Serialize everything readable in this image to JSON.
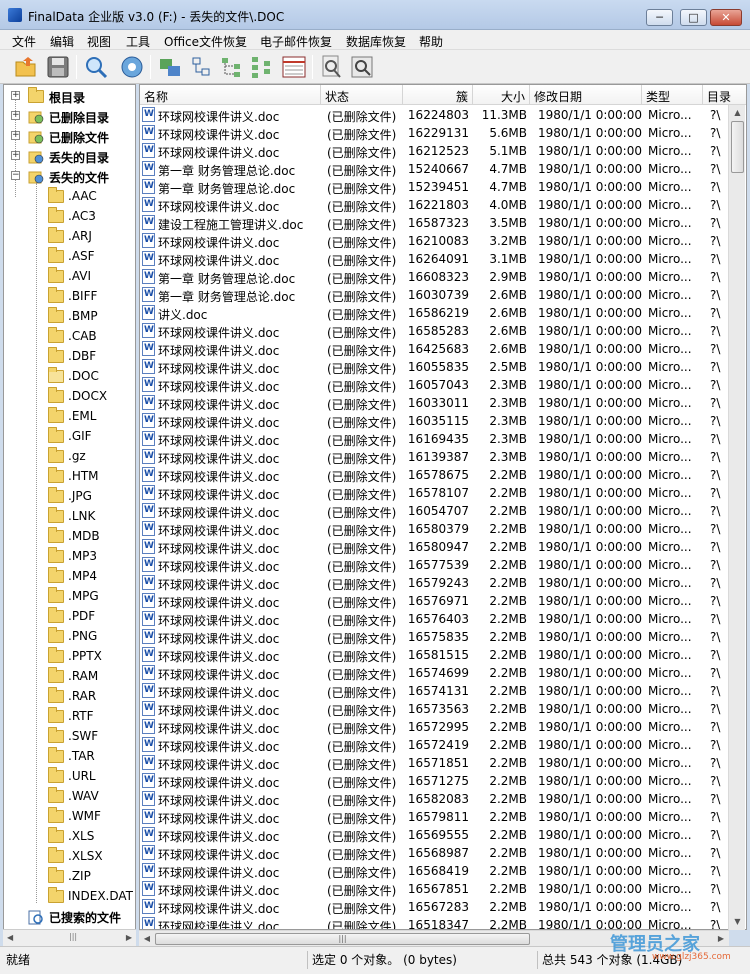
{
  "window": {
    "title": "FinalData 企业版 v3.0 (F:) - 丢失的文件\\.DOC",
    "minimize": "─",
    "maximize": "□",
    "close": "✕"
  },
  "menu": [
    "文件",
    "编辑",
    "视图",
    "工具",
    "Office文件恢复",
    "电子邮件恢复",
    "数据库恢复",
    "帮助"
  ],
  "toolbar_icons": [
    "open-folder-icon",
    "save-icon",
    "search-icon",
    "settings-gear-icon",
    "recover-icon",
    "tree-view-icon",
    "branch-icon",
    "hierarchy-icon",
    "detail-list-icon",
    "find-icon",
    "properties-icon"
  ],
  "tree": {
    "roots": [
      {
        "label": "根目录",
        "icon": "folder-icon"
      },
      {
        "label": "已删除目录",
        "icon": "deleted-folder-icon"
      },
      {
        "label": "已删除文件",
        "icon": "deleted-file-icon"
      },
      {
        "label": "丢失的目录",
        "icon": "lost-folder-icon"
      },
      {
        "label": "丢失的文件",
        "icon": "lost-file-icon"
      }
    ],
    "children": [
      ".AAC",
      ".AC3",
      ".ARJ",
      ".ASF",
      ".AVI",
      ".BIFF",
      ".BMP",
      ".CAB",
      ".DBF",
      ".DOC",
      ".DOCX",
      ".EML",
      ".GIF",
      ".gz",
      ".HTM",
      ".JPG",
      ".LNK",
      ".MDB",
      ".MP3",
      ".MP4",
      ".MPG",
      ".PDF",
      ".PNG",
      ".PPTX",
      ".RAM",
      ".RAR",
      ".RTF",
      ".SWF",
      ".TAR",
      ".URL",
      ".WAV",
      ".WMF",
      ".XLS",
      ".XLSX",
      ".ZIP",
      "INDEX.DAT"
    ],
    "search_result": "已搜索的文件"
  },
  "list": {
    "columns": [
      "名称",
      "状态",
      "簇",
      "大小",
      "修改日期",
      "类型",
      "目录"
    ],
    "rows": [
      [
        "环球网校课件讲义.doc",
        "(已删除文件)",
        "16224803",
        "11.3MB",
        "1980/1/1 0:00:00",
        "Micro...",
        "?\\"
      ],
      [
        "环球网校课件讲义.doc",
        "(已删除文件)",
        "16229131",
        "5.6MB",
        "1980/1/1 0:00:00",
        "Micro...",
        "?\\"
      ],
      [
        "环球网校课件讲义.doc",
        "(已删除文件)",
        "16212523",
        "5.1MB",
        "1980/1/1 0:00:00",
        "Micro...",
        "?\\"
      ],
      [
        "第一章  财务管理总论.doc",
        "(已删除文件)",
        "15240667",
        "4.7MB",
        "1980/1/1 0:00:00",
        "Micro...",
        "?\\"
      ],
      [
        "第一章  财务管理总论.doc",
        "(已删除文件)",
        "15239451",
        "4.7MB",
        "1980/1/1 0:00:00",
        "Micro...",
        "?\\"
      ],
      [
        "环球网校课件讲义.doc",
        "(已删除文件)",
        "16221803",
        "4.0MB",
        "1980/1/1 0:00:00",
        "Micro...",
        "?\\"
      ],
      [
        "建设工程施工管理讲义.doc",
        "(已删除文件)",
        "16587323",
        "3.5MB",
        "1980/1/1 0:00:00",
        "Micro...",
        "?\\"
      ],
      [
        "环球网校课件讲义.doc",
        "(已删除文件)",
        "16210083",
        "3.2MB",
        "1980/1/1 0:00:00",
        "Micro...",
        "?\\"
      ],
      [
        "环球网校课件讲义.doc",
        "(已删除文件)",
        "16264091",
        "3.1MB",
        "1980/1/1 0:00:00",
        "Micro...",
        "?\\"
      ],
      [
        "第一章  财务管理总论.doc",
        "(已删除文件)",
        "16608323",
        "2.9MB",
        "1980/1/1 0:00:00",
        "Micro...",
        "?\\"
      ],
      [
        "第一章  财务管理总论.doc",
        "(已删除文件)",
        "16030739",
        "2.6MB",
        "1980/1/1 0:00:00",
        "Micro...",
        "?\\"
      ],
      [
        "讲义.doc",
        "(已删除文件)",
        "16586219",
        "2.6MB",
        "1980/1/1 0:00:00",
        "Micro...",
        "?\\"
      ],
      [
        "环球网校课件讲义.doc",
        "(已删除文件)",
        "16585283",
        "2.6MB",
        "1980/1/1 0:00:00",
        "Micro...",
        "?\\"
      ],
      [
        "环球网校课件讲义.doc",
        "(已删除文件)",
        "16425683",
        "2.6MB",
        "1980/1/1 0:00:00",
        "Micro...",
        "?\\"
      ],
      [
        "环球网校课件讲义.doc",
        "(已删除文件)",
        "16055835",
        "2.5MB",
        "1980/1/1 0:00:00",
        "Micro...",
        "?\\"
      ],
      [
        "环球网校课件讲义.doc",
        "(已删除文件)",
        "16057043",
        "2.3MB",
        "1980/1/1 0:00:00",
        "Micro...",
        "?\\"
      ],
      [
        "环球网校课件讲义.doc",
        "(已删除文件)",
        "16033011",
        "2.3MB",
        "1980/1/1 0:00:00",
        "Micro...",
        "?\\"
      ],
      [
        "环球网校课件讲义.doc",
        "(已删除文件)",
        "16035115",
        "2.3MB",
        "1980/1/1 0:00:00",
        "Micro...",
        "?\\"
      ],
      [
        "环球网校课件讲义.doc",
        "(已删除文件)",
        "16169435",
        "2.3MB",
        "1980/1/1 0:00:00",
        "Micro...",
        "?\\"
      ],
      [
        "环球网校课件讲义.doc",
        "(已删除文件)",
        "16139387",
        "2.3MB",
        "1980/1/1 0:00:00",
        "Micro...",
        "?\\"
      ],
      [
        "环球网校课件讲义.doc",
        "(已删除文件)",
        "16578675",
        "2.2MB",
        "1980/1/1 0:00:00",
        "Micro...",
        "?\\"
      ],
      [
        "环球网校课件讲义.doc",
        "(已删除文件)",
        "16578107",
        "2.2MB",
        "1980/1/1 0:00:00",
        "Micro...",
        "?\\"
      ],
      [
        "环球网校课件讲义.doc",
        "(已删除文件)",
        "16054707",
        "2.2MB",
        "1980/1/1 0:00:00",
        "Micro...",
        "?\\"
      ],
      [
        "环球网校课件讲义.doc",
        "(已删除文件)",
        "16580379",
        "2.2MB",
        "1980/1/1 0:00:00",
        "Micro...",
        "?\\"
      ],
      [
        "环球网校课件讲义.doc",
        "(已删除文件)",
        "16580947",
        "2.2MB",
        "1980/1/1 0:00:00",
        "Micro...",
        "?\\"
      ],
      [
        "环球网校课件讲义.doc",
        "(已删除文件)",
        "16577539",
        "2.2MB",
        "1980/1/1 0:00:00",
        "Micro...",
        "?\\"
      ],
      [
        "环球网校课件讲义.doc",
        "(已删除文件)",
        "16579243",
        "2.2MB",
        "1980/1/1 0:00:00",
        "Micro...",
        "?\\"
      ],
      [
        "环球网校课件讲义.doc",
        "(已删除文件)",
        "16576971",
        "2.2MB",
        "1980/1/1 0:00:00",
        "Micro...",
        "?\\"
      ],
      [
        "环球网校课件讲义.doc",
        "(已删除文件)",
        "16576403",
        "2.2MB",
        "1980/1/1 0:00:00",
        "Micro...",
        "?\\"
      ],
      [
        "环球网校课件讲义.doc",
        "(已删除文件)",
        "16575835",
        "2.2MB",
        "1980/1/1 0:00:00",
        "Micro...",
        "?\\"
      ],
      [
        "环球网校课件讲义.doc",
        "(已删除文件)",
        "16581515",
        "2.2MB",
        "1980/1/1 0:00:00",
        "Micro...",
        "?\\"
      ],
      [
        "环球网校课件讲义.doc",
        "(已删除文件)",
        "16574699",
        "2.2MB",
        "1980/1/1 0:00:00",
        "Micro...",
        "?\\"
      ],
      [
        "环球网校课件讲义.doc",
        "(已删除文件)",
        "16574131",
        "2.2MB",
        "1980/1/1 0:00:00",
        "Micro...",
        "?\\"
      ],
      [
        "环球网校课件讲义.doc",
        "(已删除文件)",
        "16573563",
        "2.2MB",
        "1980/1/1 0:00:00",
        "Micro...",
        "?\\"
      ],
      [
        "环球网校课件讲义.doc",
        "(已删除文件)",
        "16572995",
        "2.2MB",
        "1980/1/1 0:00:00",
        "Micro...",
        "?\\"
      ],
      [
        "环球网校课件讲义.doc",
        "(已删除文件)",
        "16572419",
        "2.2MB",
        "1980/1/1 0:00:00",
        "Micro...",
        "?\\"
      ],
      [
        "环球网校课件讲义.doc",
        "(已删除文件)",
        "16571851",
        "2.2MB",
        "1980/1/1 0:00:00",
        "Micro...",
        "?\\"
      ],
      [
        "环球网校课件讲义.doc",
        "(已删除文件)",
        "16571275",
        "2.2MB",
        "1980/1/1 0:00:00",
        "Micro...",
        "?\\"
      ],
      [
        "环球网校课件讲义.doc",
        "(已删除文件)",
        "16582083",
        "2.2MB",
        "1980/1/1 0:00:00",
        "Micro...",
        "?\\"
      ],
      [
        "环球网校课件讲义.doc",
        "(已删除文件)",
        "16579811",
        "2.2MB",
        "1980/1/1 0:00:00",
        "Micro...",
        "?\\"
      ],
      [
        "环球网校课件讲义.doc",
        "(已删除文件)",
        "16569555",
        "2.2MB",
        "1980/1/1 0:00:00",
        "Micro...",
        "?\\"
      ],
      [
        "环球网校课件讲义.doc",
        "(已删除文件)",
        "16568987",
        "2.2MB",
        "1980/1/1 0:00:00",
        "Micro...",
        "?\\"
      ],
      [
        "环球网校课件讲义.doc",
        "(已删除文件)",
        "16568419",
        "2.2MB",
        "1980/1/1 0:00:00",
        "Micro...",
        "?\\"
      ],
      [
        "环球网校课件讲义.doc",
        "(已删除文件)",
        "16567851",
        "2.2MB",
        "1980/1/1 0:00:00",
        "Micro...",
        "?\\"
      ],
      [
        "环球网校课件讲义.doc",
        "(已删除文件)",
        "16567283",
        "2.2MB",
        "1980/1/1 0:00:00",
        "Micro...",
        "?\\"
      ],
      [
        "环球网校课件讲义.doc",
        "(已删除文件)",
        "16518347",
        "2.2MB",
        "1980/1/1 0:00:00",
        "Micro...",
        "?\\"
      ]
    ]
  },
  "status": {
    "ready": "就绪",
    "selected": "选定 0 个对象。 (0 bytes)",
    "total": "总共 543 个对象 (1.4GB)"
  },
  "watermark": {
    "text": "管理员之家",
    "sub": "www.glzj365.com"
  }
}
